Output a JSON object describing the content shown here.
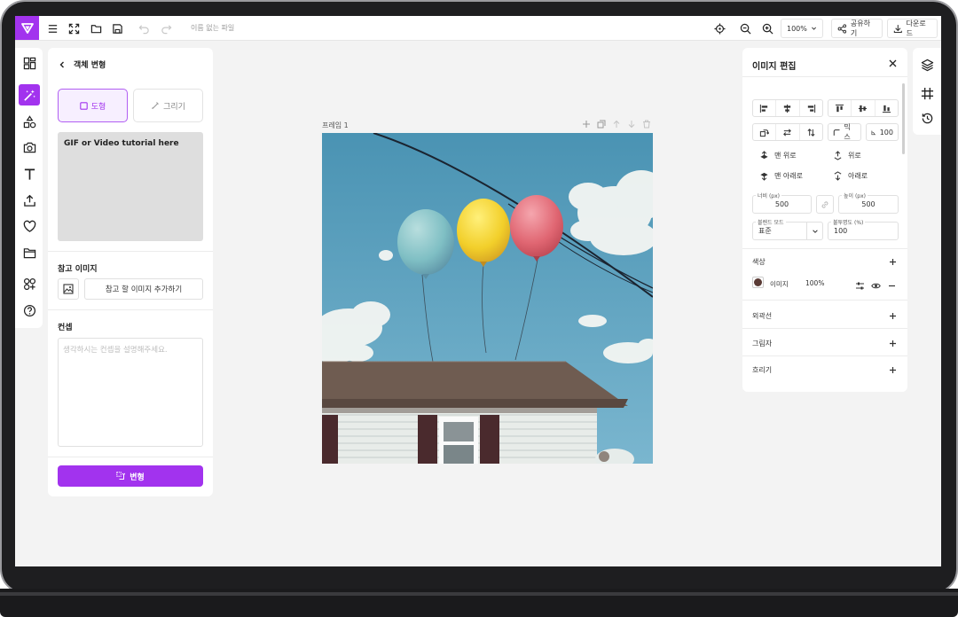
{
  "app": {
    "accent": "#a233ee",
    "file_name": "이름 없는 파일"
  },
  "toolbar": {
    "zoom": "100%",
    "share_label": "공유하기",
    "download_label": "다운로드"
  },
  "left_panel": {
    "title": "객체 변형",
    "mode_shape_label": "도형",
    "mode_draw_label": "그리기",
    "tutorial_text": "GIF or Video tutorial here",
    "reference_section": "참고 이미지",
    "add_reference_label": "참고 할 이미지 추가하기",
    "concept_section": "컨셉",
    "concept_placeholder": "생각하시는 컨셉을 설명해주세요.",
    "transform_button": "변형"
  },
  "canvas": {
    "frame_label": "프레임 1"
  },
  "right_panel": {
    "title": "이미지 편집",
    "mix_label": "믹스",
    "corner_value": "100",
    "order": {
      "front": "맨 위로",
      "up": "위로",
      "back": "맨 아래로",
      "down": "아래로"
    },
    "width_label": "너비 (px)",
    "width_value": "500",
    "height_label": "높이 (px)",
    "height_value": "500",
    "blend_label": "블렌드 모드",
    "blend_value": "표준",
    "opacity_label": "불투명도 (%)",
    "opacity_value": "100",
    "color_section": "색상",
    "layer_name": "이미지",
    "layer_opacity": "100%",
    "stroke_section": "외곽선",
    "shadow_section": "그림자",
    "blur_section": "흐리기"
  }
}
